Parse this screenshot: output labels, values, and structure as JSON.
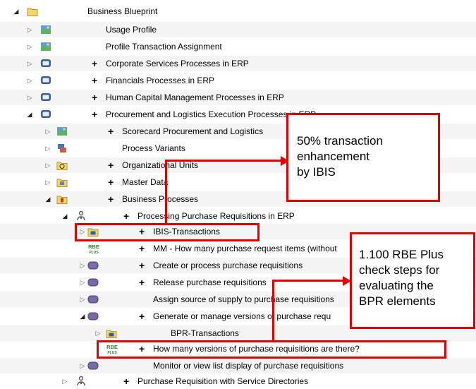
{
  "tree": {
    "rows": [
      {
        "label": "Business Blueprint",
        "plus": false,
        "expander": "open",
        "icon": "folder-icon"
      },
      {
        "label": "Usage Profile",
        "plus": false,
        "expander": "closed",
        "icon": "map-icon"
      },
      {
        "label": "Profile Transaction Assignment",
        "plus": false,
        "expander": "closed",
        "icon": "map-icon"
      },
      {
        "label": "Corporate Services Processes in ERP",
        "plus": true,
        "expander": "closed",
        "icon": "monitor-icon"
      },
      {
        "label": "Financials Processes in ERP",
        "plus": true,
        "expander": "closed",
        "icon": "monitor-icon"
      },
      {
        "label": "Human Capital Management Processes in ERP",
        "plus": true,
        "expander": "closed",
        "icon": "monitor-icon"
      },
      {
        "label": "Procurement and Logistics Execution Processes in ERP",
        "plus": true,
        "expander": "open",
        "icon": "monitor-icon"
      },
      {
        "label": "Scorecard Procurement and Logistics",
        "plus": true,
        "expander": "closed",
        "icon": "map-icon"
      },
      {
        "label": "Process Variants",
        "plus": false,
        "expander": "closed",
        "icon": "variants-icon"
      },
      {
        "label": "Organizational Units",
        "plus": true,
        "expander": "closed",
        "icon": "org-units-icon"
      },
      {
        "label": "Master Data",
        "plus": true,
        "expander": "closed",
        "icon": "master-data-icon"
      },
      {
        "label": "Business Processes",
        "plus": true,
        "expander": "open",
        "icon": "business-processes-icon"
      },
      {
        "label": "Processing Purchase Requisitions in ERP",
        "plus": true,
        "expander": "open",
        "icon": "process-icon"
      },
      {
        "label": "IBIS-Transactions",
        "plus": true,
        "expander": "closed",
        "icon": "folder-transactions-icon"
      },
      {
        "label": "MM - How many purchase request items (without",
        "plus": true,
        "expander": "none",
        "icon": "rbe-plus-icon"
      },
      {
        "label": "Create or process purchase requisitions",
        "plus": true,
        "expander": "closed",
        "icon": "step-icon"
      },
      {
        "label": "Release purchase requisitions",
        "plus": true,
        "expander": "closed",
        "icon": "step-icon"
      },
      {
        "label": "Assign source of supply to purchase requisitions",
        "plus": false,
        "expander": "closed",
        "icon": "step-icon"
      },
      {
        "label": "Generate or manage versions of purchase requ",
        "plus": true,
        "expander": "open",
        "icon": "step-icon"
      },
      {
        "label": "BPR-Transactions",
        "plus": false,
        "expander": "closed",
        "icon": "folder-transactions-icon"
      },
      {
        "label": "How many versions of purchase requisitions are there?",
        "plus": true,
        "expander": "none",
        "icon": "rbe-plus-icon"
      },
      {
        "label": "Monitor or view list display of purchase requisitions",
        "plus": false,
        "expander": "closed",
        "icon": "step-icon"
      },
      {
        "label": "Purchase Requisition with Service Directories",
        "plus": true,
        "expander": "closed",
        "icon": "process-icon"
      }
    ]
  },
  "callouts": {
    "ibis_note": "50% transaction\nenhancement\nby IBIS",
    "rbe_note": "1.100 RBE Plus\ncheck steps for\nevaluating the\nBPR elements"
  },
  "icon_text": {
    "rbe_top": "RBE",
    "rbe_bottom": "PLUS"
  },
  "colors": {
    "highlight_red": "#e00000",
    "folder_yellow": "#f5d56a",
    "monitor_blue": "#3a5f98",
    "step_purple": "#7a6aa8",
    "rbe_green": "#2e8b2e"
  }
}
